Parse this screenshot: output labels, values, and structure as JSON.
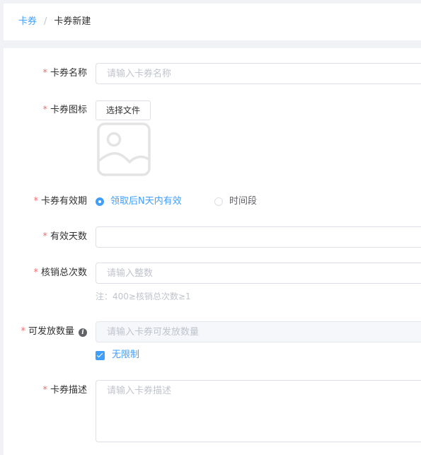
{
  "breadcrumb": {
    "parent": "卡券",
    "separator": "/",
    "current": "卡券新建"
  },
  "form": {
    "required_mark": "*",
    "name": {
      "label": "卡券名称",
      "placeholder": "请输入卡券名称"
    },
    "icon": {
      "label": "卡券图标",
      "button": "选择文件"
    },
    "validity": {
      "label": "卡券有效期",
      "options": [
        "领取后N天内有效",
        "时间段"
      ],
      "selected": "领取后N天内有效"
    },
    "valid_days": {
      "label": "有效天数",
      "value": ""
    },
    "redeem_count": {
      "label": "核销总次数",
      "placeholder": "请输入整数",
      "hint": "注：400≥核销总次数≥1"
    },
    "issue_qty": {
      "label": "可发放数量",
      "info_icon": "i",
      "placeholder": "请输入卡券可发放数量",
      "unlimited_label": "无限制",
      "unlimited_checked": true
    },
    "description": {
      "label": "卡券描述",
      "placeholder": "请输入卡券描述"
    }
  },
  "colors": {
    "primary": "#409eff",
    "required": "#f56c6c",
    "placeholder": "#c0c4cc",
    "border": "#dcdfe6"
  }
}
